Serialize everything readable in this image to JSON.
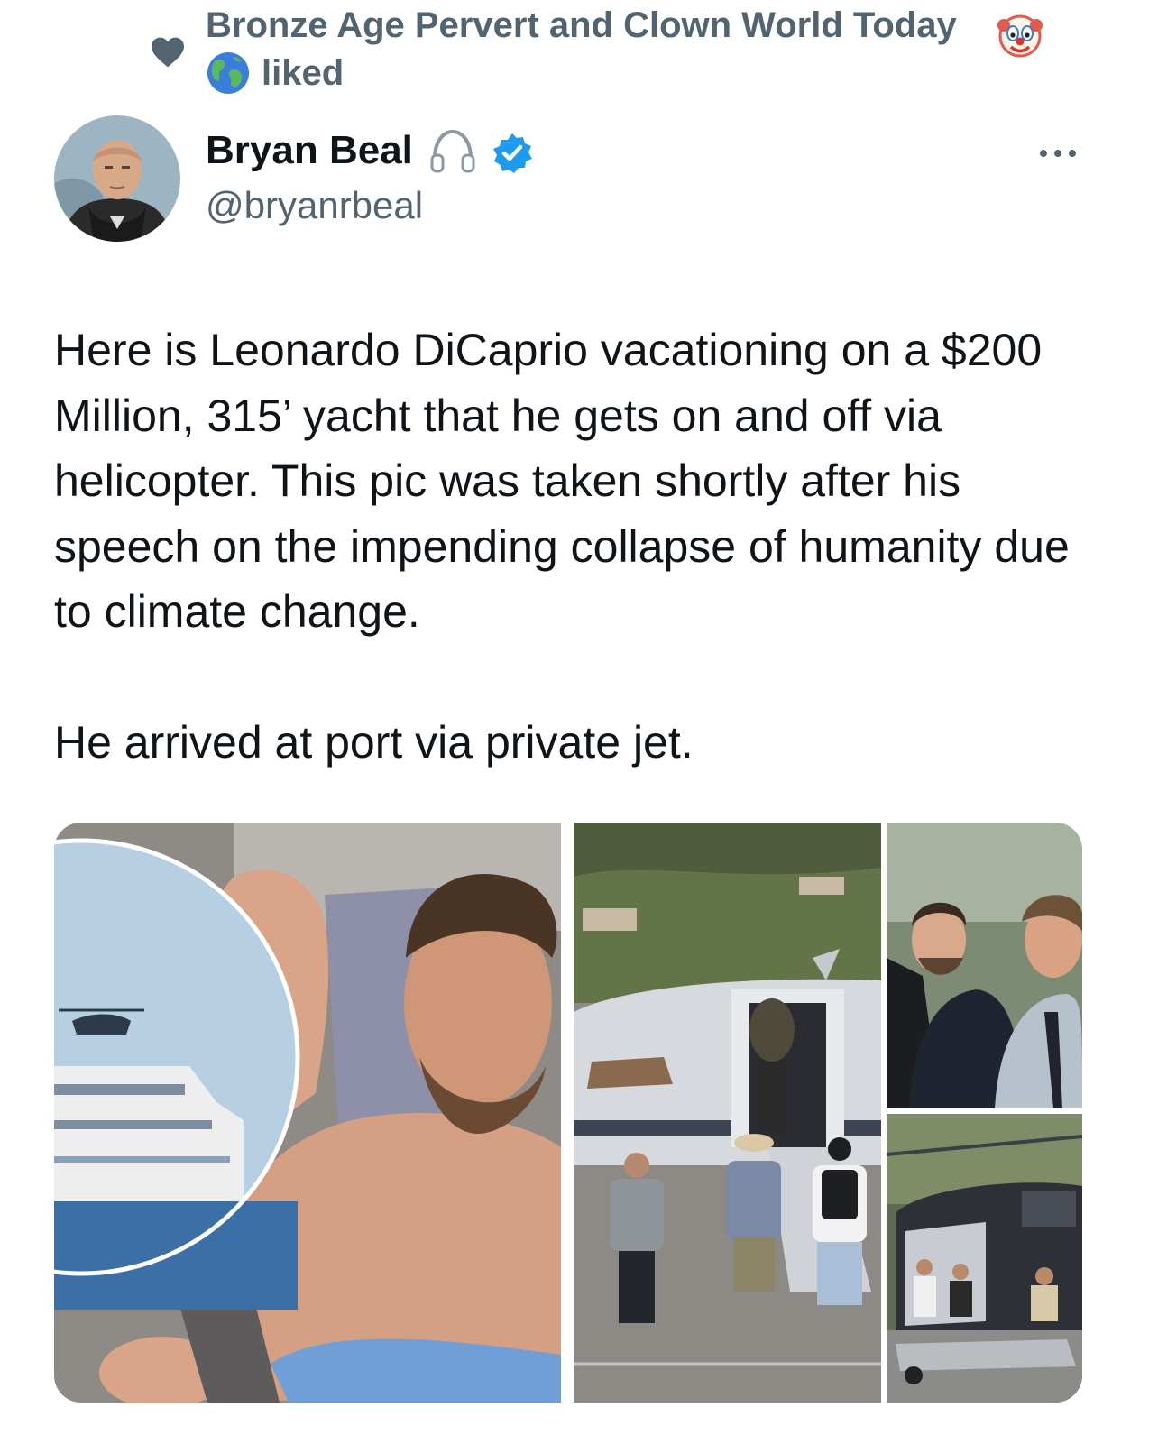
{
  "social_context": {
    "liker_name": "Bronze Age Pervert and Clown World Today",
    "action": "liked",
    "icons": [
      "heart-icon",
      "clown-face-icon",
      "globe-icon"
    ]
  },
  "author": {
    "name": "Bryan Beal",
    "handle": "@bryanrbeal",
    "verified": true,
    "badges": [
      "headphones-icon",
      "verified-badge-icon"
    ],
    "accent_color": "#1d9bf0"
  },
  "tweet": {
    "paragraphs": [
      "Here is Leonardo DiCaprio vacationing on a $200 Million, 315’ yacht that he gets on and off via helicopter. This pic was taken shortly after his speech on the impending collapse of humanity due to climate change.",
      "He arrived at port via private jet."
    ]
  },
  "media": {
    "photo_count": 4,
    "photos": [
      "sunbathing-on-yacht-photo",
      "boarding-private-jet-photo",
      "two-men-close-up-photo",
      "helicopter-photo"
    ]
  },
  "menu": {
    "icon": "more-options-icon"
  }
}
